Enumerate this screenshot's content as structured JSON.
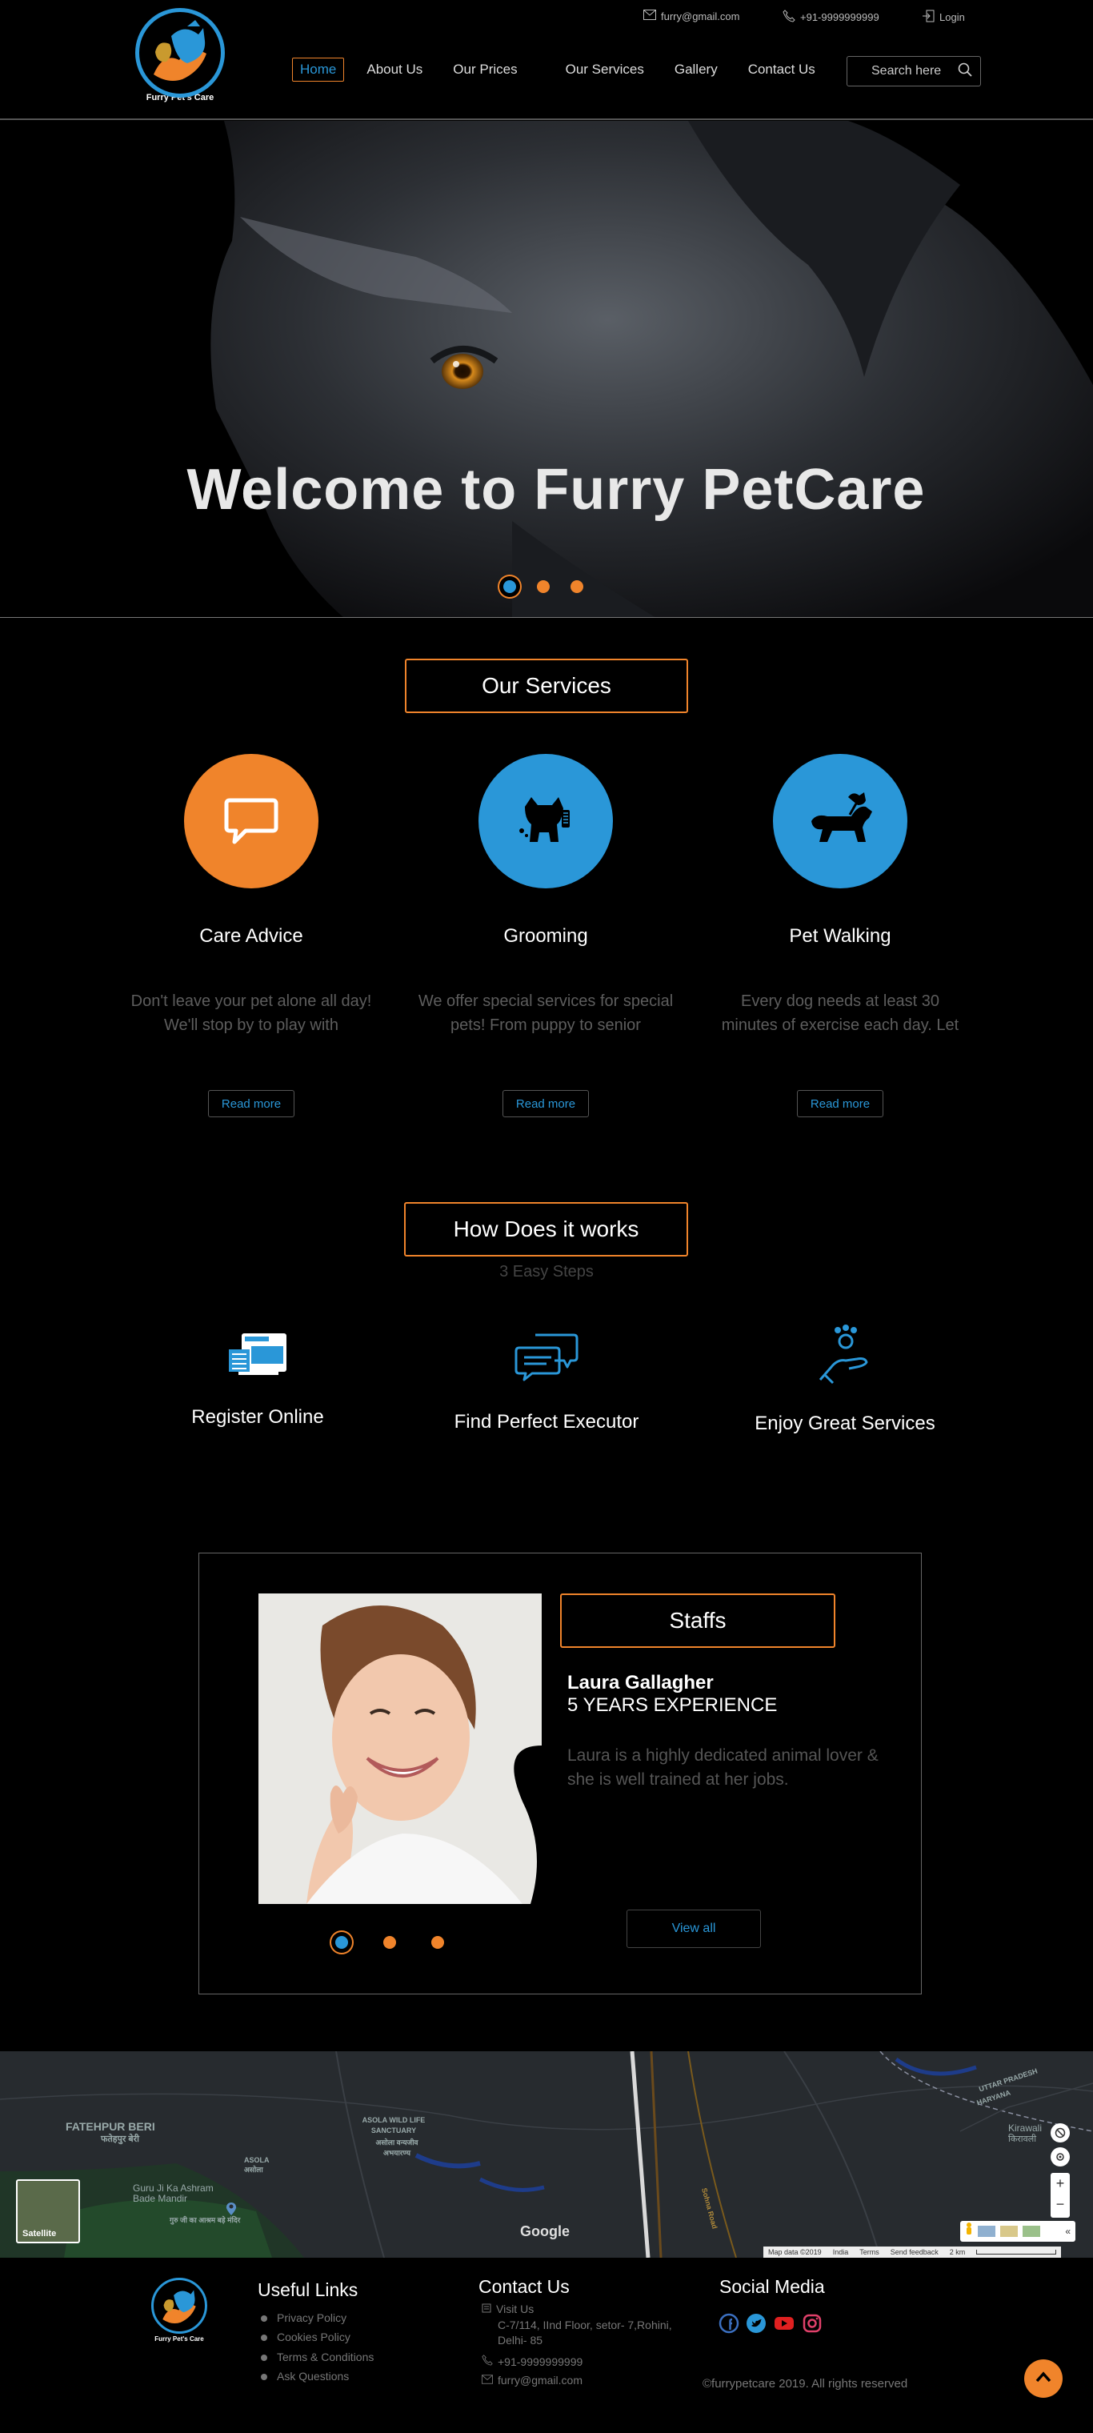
{
  "brand": {
    "name": "Furry Pet's Care"
  },
  "topbar": {
    "email": "furry@gmail.com",
    "phone": "+91-9999999999",
    "login": "Login"
  },
  "nav": {
    "items": [
      "Home",
      "About Us",
      "Our Prices",
      "Our Services",
      "Gallery",
      "Contact Us"
    ],
    "active": "Home"
  },
  "search": {
    "placeholder": "Search here"
  },
  "hero": {
    "title": "Welcome to Furry PetCare",
    "slides": 3,
    "active_slide": 1
  },
  "services": {
    "title": "Our Services",
    "items": [
      {
        "name": "Care Advice",
        "desc": "Don't leave your pet alone all day! We'll stop by to play with",
        "button": "Read more",
        "icon": "chat-bubble-icon",
        "color": "#f0842b"
      },
      {
        "name": "Grooming",
        "desc": "We offer special services for special pets! From puppy to senior",
        "button": "Read more",
        "icon": "dog-grooming-icon",
        "color": "#2a97d8"
      },
      {
        "name": "Pet Walking",
        "desc": "Every dog needs at least 30 minutes of exercise each day. Let",
        "button": "Read more",
        "icon": "dog-walking-icon",
        "color": "#2a97d8"
      }
    ]
  },
  "how": {
    "title": "How Does it works",
    "subtitle": "3 Easy Steps",
    "steps": [
      {
        "name": "Register Online",
        "icon": "register-form-icon"
      },
      {
        "name": "Find Perfect Executor",
        "icon": "chat-messages-icon"
      },
      {
        "name": "Enjoy Great Services",
        "icon": "paw-hand-icon"
      }
    ]
  },
  "staffs": {
    "title": "Staffs",
    "name": "Laura Gallagher",
    "experience": "5 YEARS EXPERIENCE",
    "desc": "Laura is a highly dedicated animal lover & she is well trained at her jobs.",
    "button": "View all",
    "slides": 3,
    "active_slide": 1
  },
  "map": {
    "labels": {
      "fatehpur": "FATEHPUR BERI",
      "fatehpur_hi": "फतेहपुर बेरी",
      "asola_wild": "ASOLA WILD LIFE SANCTUARY",
      "asola_wild_hi": "असोला वन्यजीव अभयारण्य",
      "asola": "ASOLA",
      "asola_hi": "असोला",
      "ashram": "Guru Ji Ka Ashram Bade Mandir",
      "ashram_hi": "गुरु जी का आश्रम बड़े मंदिर",
      "kirawali": "Kirawali",
      "kirawali_hi": "किरावली",
      "up": "UTTAR PRADESH",
      "haryana": "HARYANA",
      "road": "Sohna Road"
    },
    "satellite": "Satellite",
    "brand": "Google",
    "attribution": [
      "Map data ©2019",
      "India",
      "Terms",
      "Send feedback",
      "2 km"
    ]
  },
  "footer": {
    "links_title": "Useful Links",
    "links": [
      "Privacy Policy",
      "Cookies Policy",
      "Terms & Conditions",
      "Ask Questions"
    ],
    "contact_title": "Contact Us",
    "visit": "Visit Us",
    "address": "C-7/114, IInd Floor, setor- 7,Rohini, Delhi- 85",
    "phone": "+91-9999999999",
    "email": "furry@gmail.com",
    "social_title": "Social Media",
    "social": [
      "facebook",
      "twitter",
      "youtube",
      "instagram"
    ],
    "copyright": "©furrypetcare 2019. All rights reserved"
  },
  "colors": {
    "accent_orange": "#f0842b",
    "accent_blue": "#2a97d8",
    "bg": "#000000"
  }
}
